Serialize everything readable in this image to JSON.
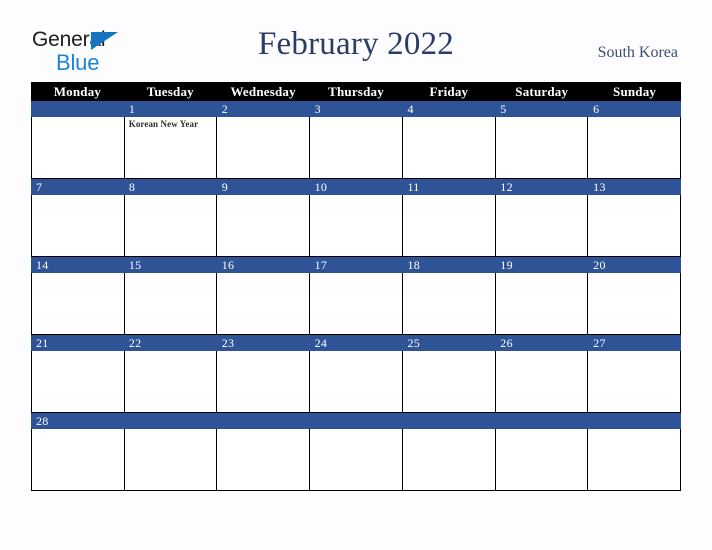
{
  "logo": {
    "word_one": "General",
    "word_two": "Blue",
    "triangle_icon": "triangle-icon",
    "color_dark": "#1d1d1b",
    "color_blue": "#1c85d6"
  },
  "header": {
    "title": "February 2022",
    "country": "South Korea",
    "title_color": "#2b3d63"
  },
  "theme": {
    "band_color": "#2e5396",
    "weekhead_bg": "#000000",
    "page_bg": "#fdfdff",
    "grid_color": "#000000"
  },
  "calendar": {
    "weekdays": [
      "Monday",
      "Tuesday",
      "Wednesday",
      "Thursday",
      "Friday",
      "Saturday",
      "Sunday"
    ],
    "weeks": [
      {
        "days": [
          {
            "num": "",
            "event": ""
          },
          {
            "num": "1",
            "event": "Korean New Year"
          },
          {
            "num": "2",
            "event": ""
          },
          {
            "num": "3",
            "event": ""
          },
          {
            "num": "4",
            "event": ""
          },
          {
            "num": "5",
            "event": ""
          },
          {
            "num": "6",
            "event": ""
          }
        ]
      },
      {
        "days": [
          {
            "num": "7",
            "event": ""
          },
          {
            "num": "8",
            "event": ""
          },
          {
            "num": "9",
            "event": ""
          },
          {
            "num": "10",
            "event": ""
          },
          {
            "num": "11",
            "event": ""
          },
          {
            "num": "12",
            "event": ""
          },
          {
            "num": "13",
            "event": ""
          }
        ]
      },
      {
        "days": [
          {
            "num": "14",
            "event": ""
          },
          {
            "num": "15",
            "event": ""
          },
          {
            "num": "16",
            "event": ""
          },
          {
            "num": "17",
            "event": ""
          },
          {
            "num": "18",
            "event": ""
          },
          {
            "num": "19",
            "event": ""
          },
          {
            "num": "20",
            "event": ""
          }
        ]
      },
      {
        "days": [
          {
            "num": "21",
            "event": ""
          },
          {
            "num": "22",
            "event": ""
          },
          {
            "num": "23",
            "event": ""
          },
          {
            "num": "24",
            "event": ""
          },
          {
            "num": "25",
            "event": ""
          },
          {
            "num": "26",
            "event": ""
          },
          {
            "num": "27",
            "event": ""
          }
        ]
      },
      {
        "days": [
          {
            "num": "28",
            "event": ""
          },
          {
            "num": "",
            "event": ""
          },
          {
            "num": "",
            "event": ""
          },
          {
            "num": "",
            "event": ""
          },
          {
            "num": "",
            "event": ""
          },
          {
            "num": "",
            "event": ""
          },
          {
            "num": "",
            "event": ""
          }
        ]
      }
    ]
  }
}
